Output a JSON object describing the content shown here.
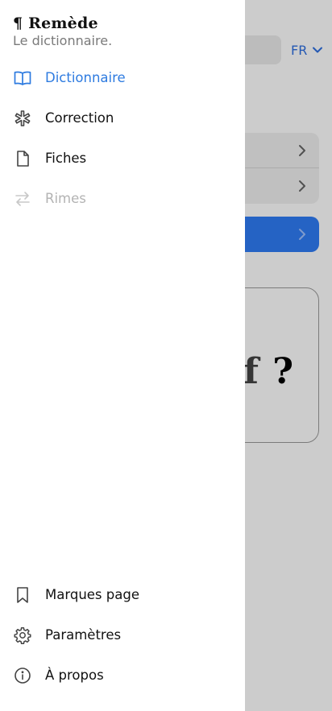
{
  "background": {
    "language_selector": {
      "label": "FR",
      "icon": "chevron-down-icon"
    },
    "word_card": {
      "visible_word": "uf",
      "question_mark": "?"
    }
  },
  "drawer": {
    "brand": "¶ Remède",
    "tagline": "Le dictionnaire.",
    "items": [
      {
        "label": "Dictionnaire",
        "icon": "book-open-icon",
        "state": "active"
      },
      {
        "label": "Correction",
        "icon": "asterisk-icon",
        "state": "normal"
      },
      {
        "label": "Fiches",
        "icon": "file-icon",
        "state": "normal"
      },
      {
        "label": "Rimes",
        "icon": "arrows-swap-icon",
        "state": "disabled"
      }
    ],
    "bottom_items": [
      {
        "label": "Marques page",
        "icon": "bookmark-icon"
      },
      {
        "label": "Paramètres",
        "icon": "gear-icon"
      },
      {
        "label": "À propos",
        "icon": "info-icon"
      }
    ]
  },
  "colors": {
    "accent": "#2e7be0",
    "disabled": "#b3b3b3",
    "scrim": "rgba(0,0,0,0.2)",
    "primary_button": "#2f7cf6"
  }
}
